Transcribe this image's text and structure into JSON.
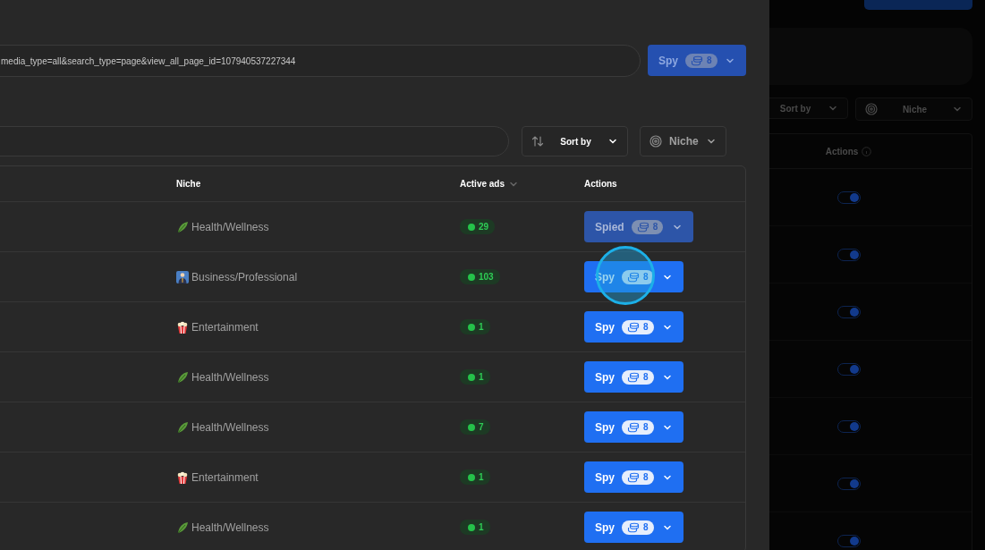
{
  "url_field": {
    "value": "media_type=all&search_type=page&view_all_page_id=107940537227344"
  },
  "spy_button": {
    "label": "Spy",
    "credits": "8"
  },
  "sort_select": {
    "label": "Sort by"
  },
  "niche_select": {
    "label": "Niche"
  },
  "table": {
    "columns": [
      {
        "label": "Niche",
        "sortable": false
      },
      {
        "label": "Active ads",
        "sortable": true
      },
      {
        "label": "Actions",
        "sortable": false
      }
    ],
    "rows": [
      {
        "kind": "leaf",
        "niche": "Health/Wellness",
        "active_ads": "29",
        "spied": true,
        "clicked": false,
        "action": "Spied",
        "credits": "8"
      },
      {
        "kind": "business",
        "niche": "Business/Professional",
        "active_ads": "103",
        "spied": false,
        "clicked": true,
        "action": "Spy",
        "credits": "8"
      },
      {
        "kind": "popcorn",
        "niche": "Entertainment",
        "active_ads": "1",
        "spied": false,
        "clicked": false,
        "action": "Spy",
        "credits": "8"
      },
      {
        "kind": "leaf",
        "niche": "Health/Wellness",
        "active_ads": "1",
        "spied": false,
        "clicked": false,
        "action": "Spy",
        "credits": "8"
      },
      {
        "kind": "leaf",
        "niche": "Health/Wellness",
        "active_ads": "7",
        "spied": false,
        "clicked": false,
        "action": "Spy",
        "credits": "8"
      },
      {
        "kind": "popcorn",
        "niche": "Entertainment",
        "active_ads": "1",
        "spied": false,
        "clicked": false,
        "action": "Spy",
        "credits": "8"
      },
      {
        "kind": "leaf",
        "niche": "Health/Wellness",
        "active_ads": "1",
        "spied": false,
        "clicked": false,
        "action": "Spy",
        "credits": "8"
      }
    ]
  },
  "backdrop": {
    "sort_select": {
      "label": "Sort by"
    },
    "niche_select": {
      "label": "Niche"
    },
    "actions_column": {
      "label": "Actions"
    },
    "toggles": [
      {
        "on": true
      },
      {
        "on": true
      },
      {
        "on": true
      },
      {
        "on": true
      },
      {
        "on": true
      },
      {
        "on": true
      },
      {
        "on": true
      }
    ]
  }
}
